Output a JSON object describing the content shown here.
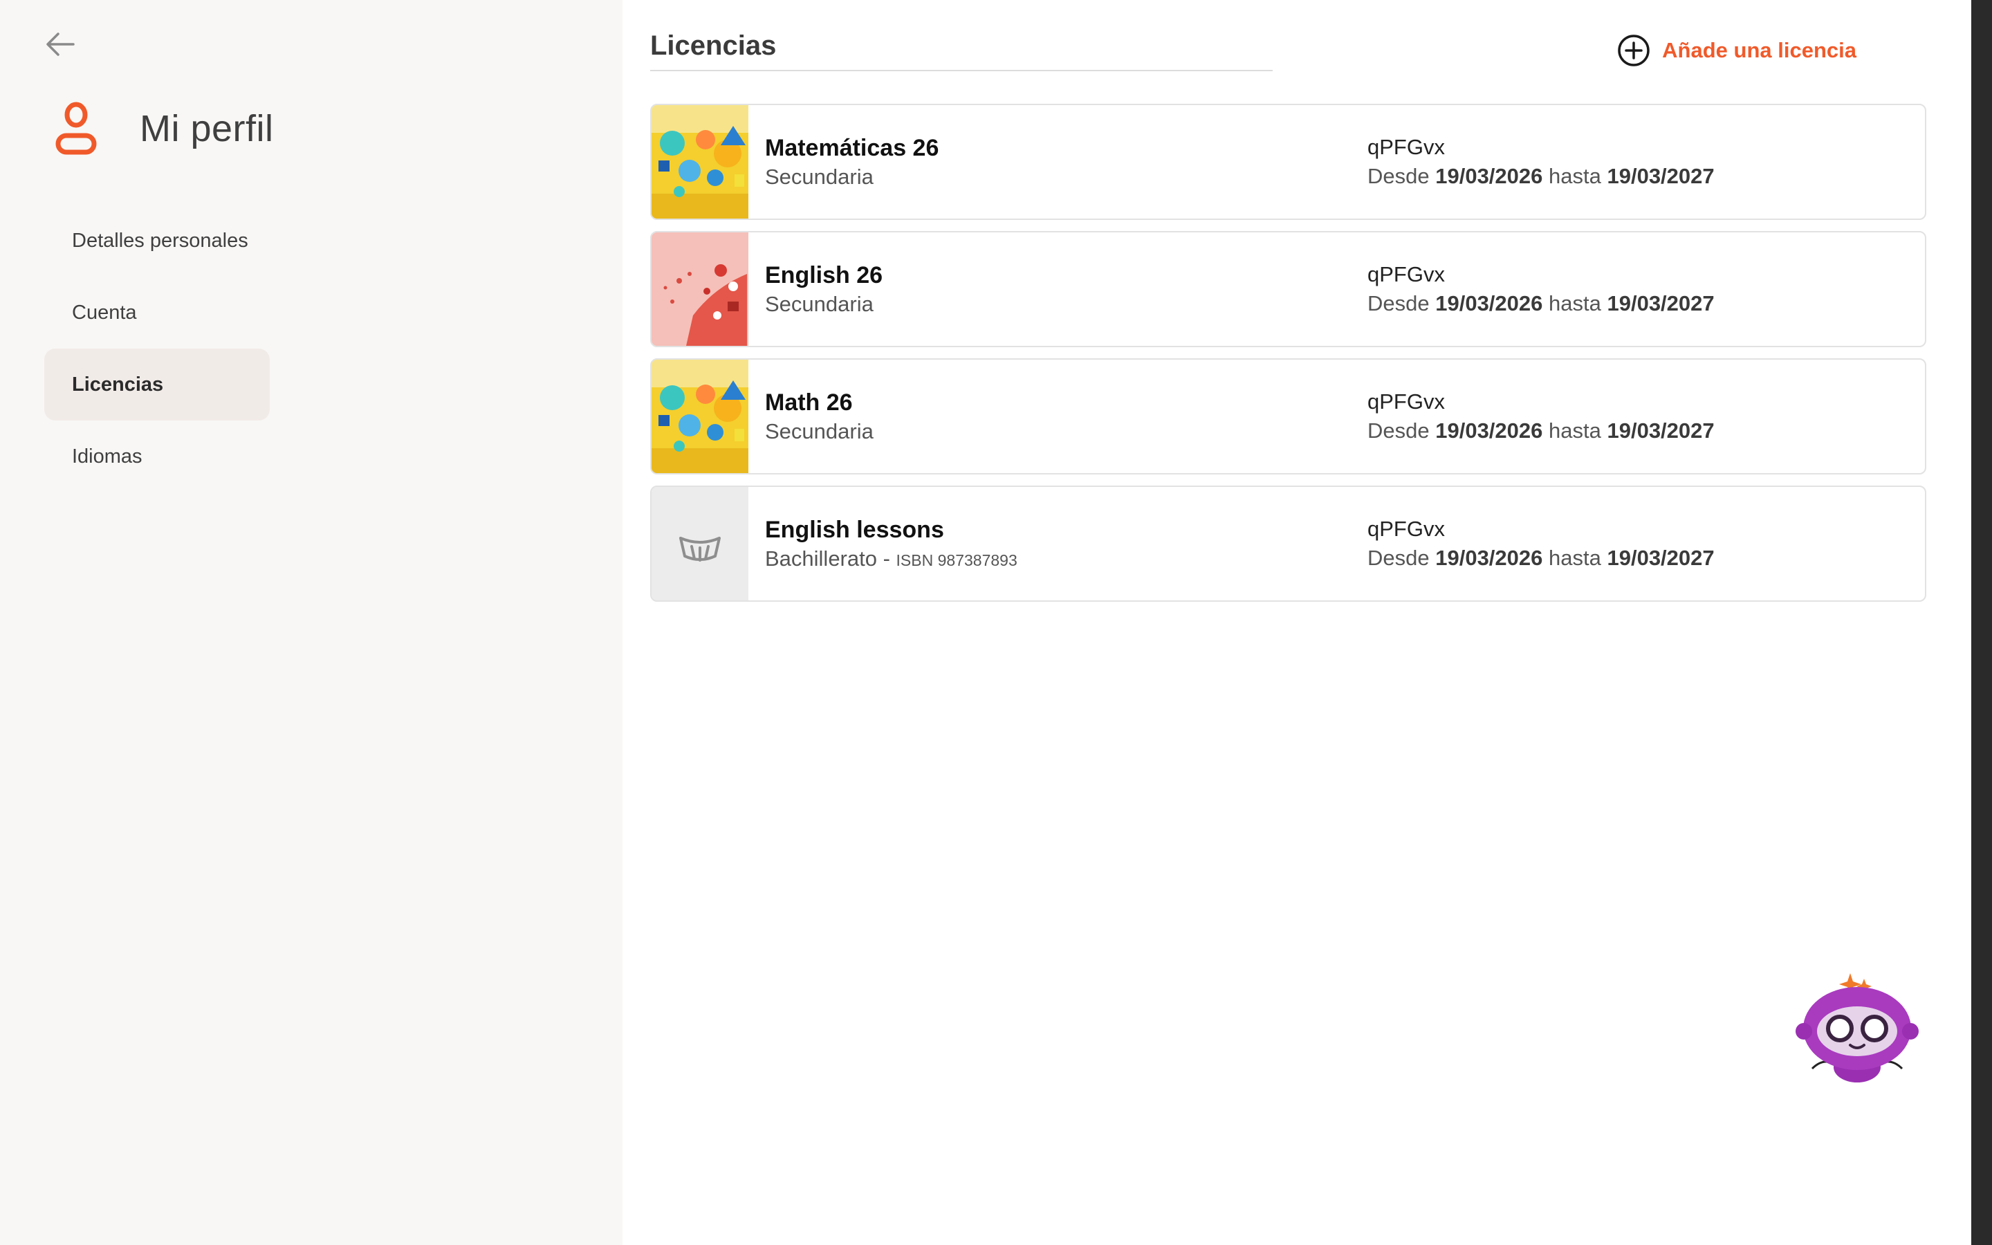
{
  "sidebar": {
    "back_icon": "arrow-left-icon",
    "profile_icon": "user-icon",
    "title": "Mi perfil",
    "items": [
      {
        "label": "Detalles personales",
        "active": false
      },
      {
        "label": "Cuenta",
        "active": false
      },
      {
        "label": "Licencias",
        "active": true
      },
      {
        "label": "Idiomas",
        "active": false
      }
    ]
  },
  "main": {
    "title": "Licencias",
    "add_label": "Añade una licencia",
    "add_icon": "plus-circle-icon",
    "accent_color": "#f05a2a",
    "licenses": [
      {
        "name": "Matemáticas 26",
        "level": "Secundaria",
        "isbn": "",
        "code": "qPFGvx",
        "from_label": "Desde",
        "from": "19/03/2026",
        "to_label": "hasta",
        "to": "19/03/2027",
        "thumb": "math-cover"
      },
      {
        "name": "English 26",
        "level": "Secundaria",
        "isbn": "",
        "code": "qPFGvx",
        "from_label": "Desde",
        "from": "19/03/2026",
        "to_label": "hasta",
        "to": "19/03/2027",
        "thumb": "english-cover"
      },
      {
        "name": "Math 26",
        "level": "Secundaria",
        "isbn": "",
        "code": "qPFGvx",
        "from_label": "Desde",
        "from": "19/03/2026",
        "to_label": "hasta",
        "to": "19/03/2027",
        "thumb": "math-cover"
      },
      {
        "name": "English lessons",
        "level": "Bachillerato",
        "isbn": "ISBN 987387893",
        "code": "qPFGvx",
        "from_label": "Desde",
        "from": "19/03/2026",
        "to_label": "hasta",
        "to": "19/03/2027",
        "thumb": "placeholder-cover"
      }
    ]
  },
  "assistant": {
    "icon": "robot-assistant-icon"
  }
}
